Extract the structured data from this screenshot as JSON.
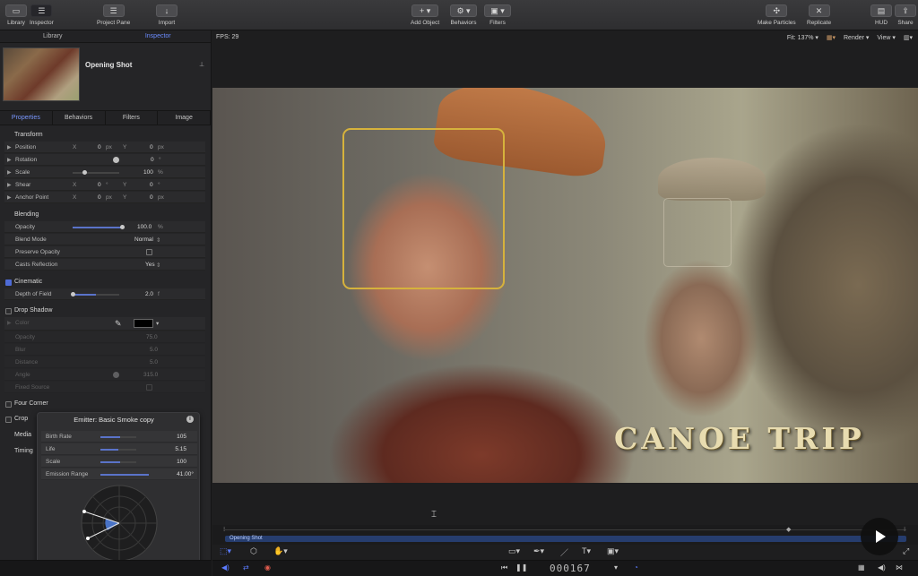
{
  "toolbar": {
    "library": "Library",
    "inspector": "Inspector",
    "project_pane": "Project Pane",
    "import": "Import",
    "add_object": "Add Object",
    "behaviors": "Behaviors",
    "filters": "Filters",
    "make_particles": "Make Particles",
    "replicate": "Replicate",
    "hud": "HUD",
    "share": "Share"
  },
  "left_tabs": {
    "library": "Library",
    "inspector": "Inspector"
  },
  "preview": {
    "title": "Opening Shot"
  },
  "inspector_tabs": [
    "Properties",
    "Behaviors",
    "Filters",
    "Image"
  ],
  "transform": {
    "header": "Transform",
    "position": {
      "label": "Position",
      "x_label": "X",
      "x": "0",
      "x_unit": "px",
      "y_label": "Y",
      "y": "0",
      "y_unit": "px"
    },
    "rotation": {
      "label": "Rotation",
      "value": "0",
      "unit": "°"
    },
    "scale": {
      "label": "Scale",
      "value": "100",
      "unit": "%"
    },
    "shear": {
      "label": "Shear",
      "x_label": "X",
      "x": "0",
      "x_unit": "°",
      "y_label": "Y",
      "y": "0",
      "y_unit": "°"
    },
    "anchor": {
      "label": "Anchor Point",
      "x_label": "X",
      "x": "0",
      "x_unit": "px",
      "y_label": "Y",
      "y": "0",
      "y_unit": "px"
    }
  },
  "blending": {
    "header": "Blending",
    "opacity": {
      "label": "Opacity",
      "value": "100.0",
      "unit": "%"
    },
    "blend_mode": {
      "label": "Blend Mode",
      "value": "Normal"
    },
    "preserve_opacity": {
      "label": "Preserve Opacity"
    },
    "casts_reflection": {
      "label": "Casts Reflection",
      "value": "Yes"
    }
  },
  "cinematic": {
    "label": "Cinematic",
    "depth_label": "Depth of Field",
    "depth_value": "2.0",
    "depth_unit": "f"
  },
  "drop_shadow": {
    "label": "Drop Shadow",
    "rows": [
      {
        "label": "Color",
        "value": ""
      },
      {
        "label": "Opacity",
        "value": "75.0"
      },
      {
        "label": "Blur",
        "value": "5.0"
      },
      {
        "label": "Distance",
        "value": "5.0"
      },
      {
        "label": "Angle",
        "value": "315.0"
      },
      {
        "label": "Fixed Source",
        "value": ""
      }
    ]
  },
  "four_corner": {
    "label": "Four Corner"
  },
  "crop": {
    "label": "Crop"
  },
  "media": {
    "label": "Media"
  },
  "timing": {
    "label": "Timing"
  },
  "emitter": {
    "title": "Emitter: Basic Smoke copy",
    "rows": [
      {
        "label": "Birth Rate",
        "value": "105"
      },
      {
        "label": "Life",
        "value": "5.15"
      },
      {
        "label": "Scale",
        "value": "100"
      },
      {
        "label": "Emission Range",
        "value": "41.00°"
      }
    ]
  },
  "canvas": {
    "fps": "FPS: 29",
    "fit": "Fit: 137%",
    "render": "Render",
    "view": "View",
    "title_overlay": "CANOE TRIP"
  },
  "timeline": {
    "clip_name": "Opening Shot"
  },
  "transport": {
    "timecode": "000167"
  },
  "colors": {
    "accent": "#5b7bff",
    "face_box": "#d6b23c",
    "title_gold": "#e8dcb0"
  }
}
